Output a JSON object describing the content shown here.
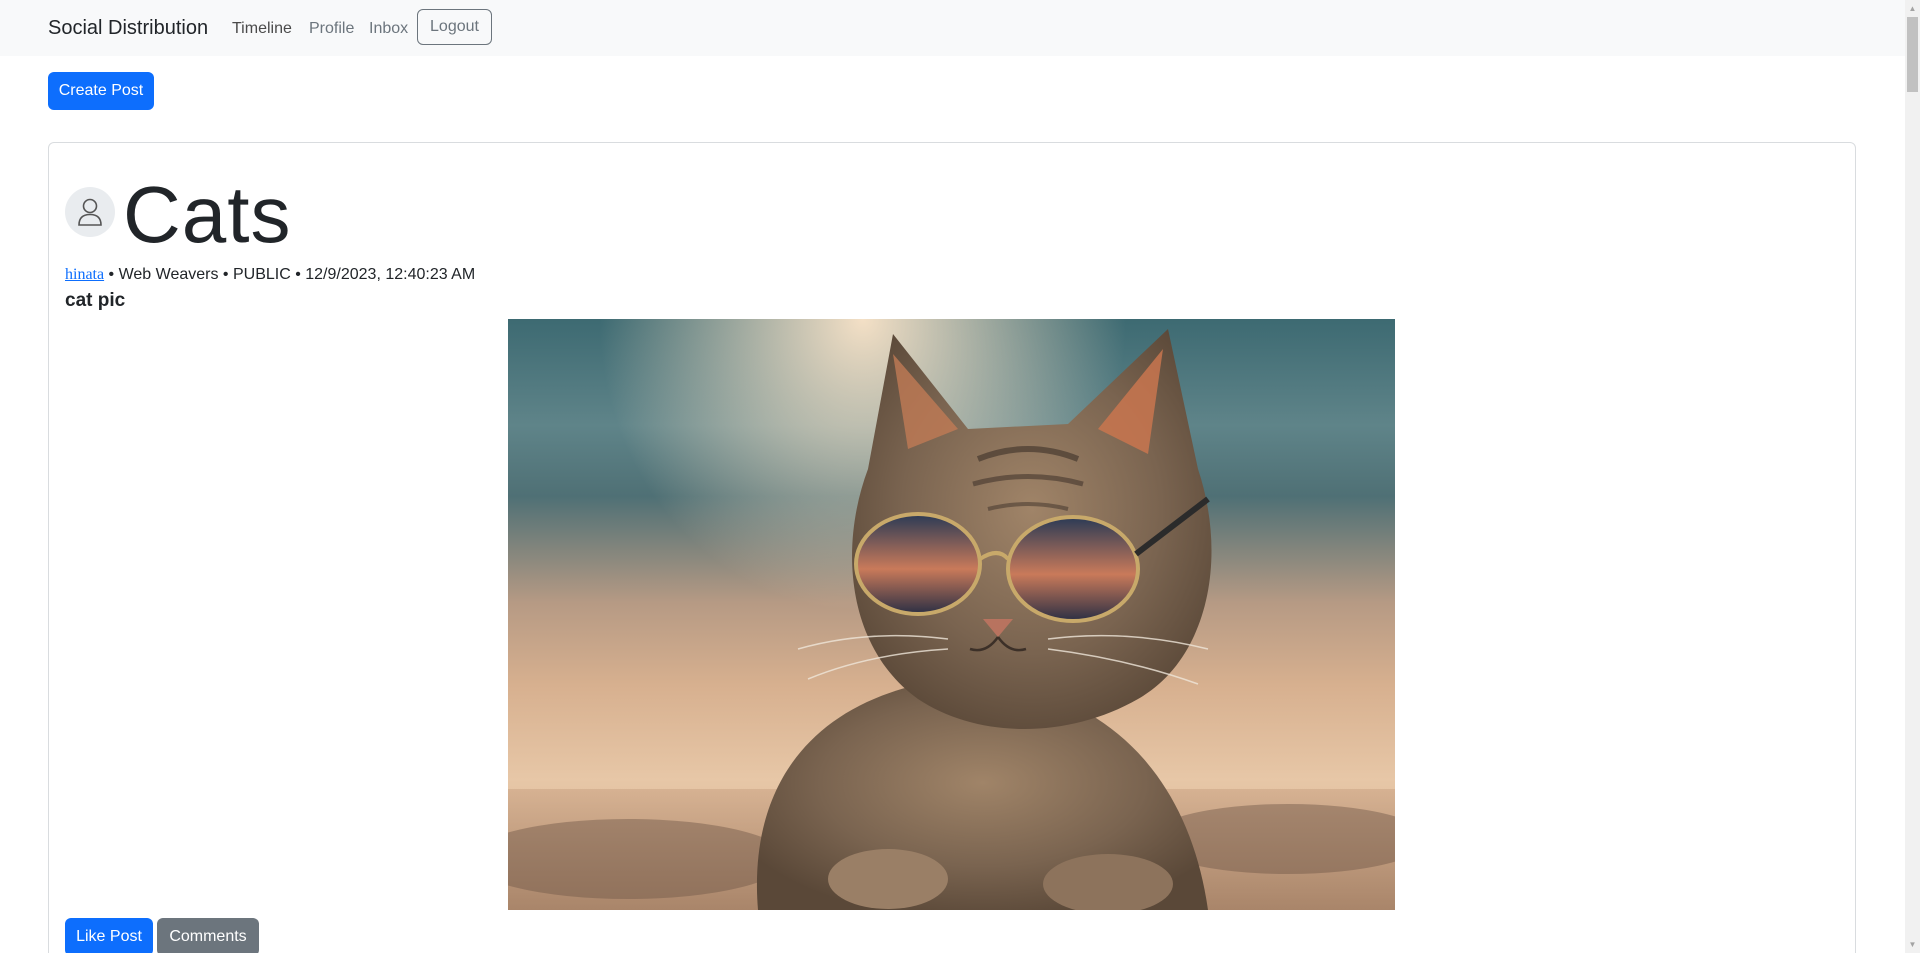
{
  "navbar": {
    "brand": "Social Distribution",
    "links": [
      "Timeline",
      "Profile",
      "Inbox"
    ],
    "logout_label": "Logout"
  },
  "toolbar": {
    "create_post_label": "Create Post"
  },
  "post": {
    "title": "Cats",
    "author": "hinata",
    "meta_rest": " • Web Weavers • PUBLIC • 12/9/2023, 12:40:23 AM",
    "description": "cat pic",
    "image_subject": "cat wearing sunglasses lying on a beach",
    "like_label": "Like Post",
    "comments_label": "Comments"
  },
  "icons": {
    "avatar": "person-icon"
  },
  "colors": {
    "primary": "#0d6efd",
    "secondary": "#6c757d",
    "navbar_bg": "#f8f9fa"
  }
}
